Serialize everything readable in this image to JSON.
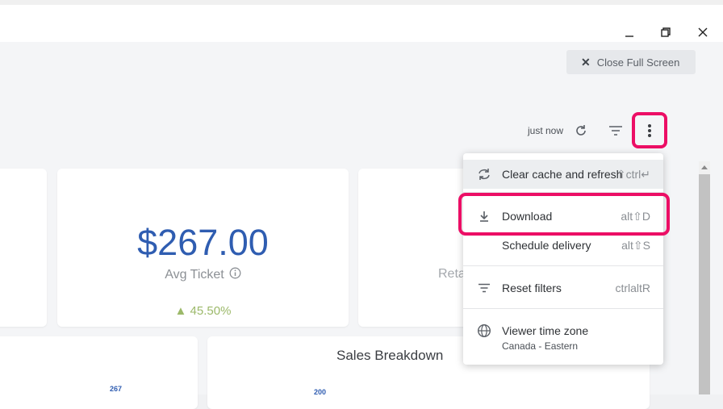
{
  "window": {
    "minimize_icon": "minimize-icon",
    "restore_icon": "restore-icon",
    "close_icon": "close-icon"
  },
  "toolbar": {
    "close_fullscreen_label": "Close Full Screen",
    "last_updated": "just now"
  },
  "kpi": {
    "avg_ticket_value": "$267.00",
    "avg_ticket_label": "Avg Ticket",
    "avg_ticket_delta": "▲ 45.50%",
    "retail_label_partial": "Reta"
  },
  "charts": {
    "left_value_label": "267",
    "sales_breakdown_title": "Sales Breakdown",
    "sales_breakdown_value_label": "200"
  },
  "menu": {
    "items": [
      {
        "label": "Clear cache and refresh",
        "shortcut": "⇧ctrl↵",
        "icon": "refresh-cache-icon"
      },
      {
        "label": "Download",
        "shortcut": "alt⇧D",
        "icon": "download-icon"
      },
      {
        "label": "Schedule delivery",
        "shortcut": "alt⇧S",
        "icon": ""
      },
      {
        "label": "Reset filters",
        "shortcut": "ctrlaltR",
        "icon": "filter-icon"
      },
      {
        "label": "Viewer time zone",
        "sublabel": "Canada - Eastern",
        "icon": "globe-icon"
      }
    ]
  },
  "colors": {
    "accent": "#2f5db1",
    "highlight": "#ec0e65",
    "positive": "#9cb96a"
  }
}
